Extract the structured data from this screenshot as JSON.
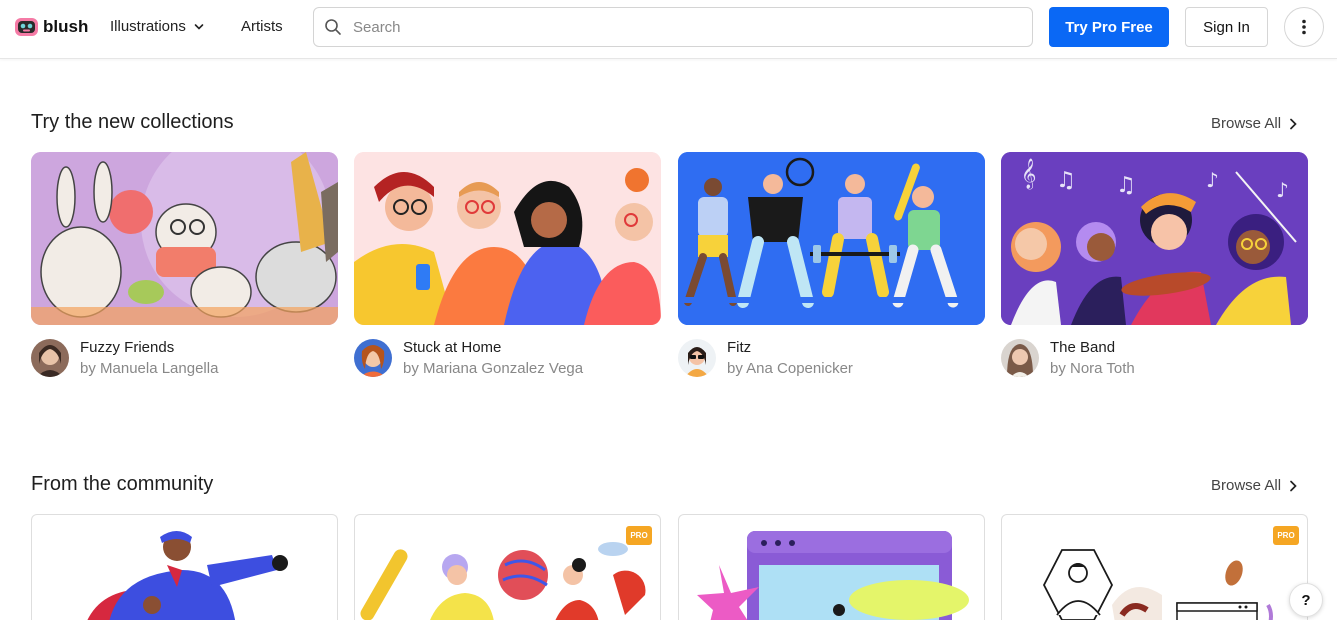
{
  "header": {
    "logo_text": "blush",
    "nav_illustrations": "Illustrations",
    "nav_artists": "Artists",
    "search_placeholder": "Search",
    "try_pro": "Try Pro Free",
    "sign_in": "Sign In"
  },
  "collections": {
    "title": "Try the new collections",
    "browse_all": "Browse All",
    "items": [
      {
        "name": "Fuzzy Friends",
        "author": "by Manuela Langella"
      },
      {
        "name": "Stuck at Home",
        "author": "by Mariana Gonzalez Vega"
      },
      {
        "name": "Fitz",
        "author": "by Ana Copenicker"
      },
      {
        "name": "The Band",
        "author": "by Nora Toth"
      }
    ]
  },
  "community": {
    "title": "From the community",
    "browse_all": "Browse All",
    "pro_label": "PRO"
  },
  "help": {
    "label": "?"
  },
  "colors": {
    "accent": "#0a68f5",
    "fuzzy_bg": "#cfa8e0",
    "stuck_bg": "#fde3e3",
    "fitz_bg": "#2a6cf0",
    "band_bg": "#6a3fbf",
    "pro_badge": "#f5a623"
  }
}
